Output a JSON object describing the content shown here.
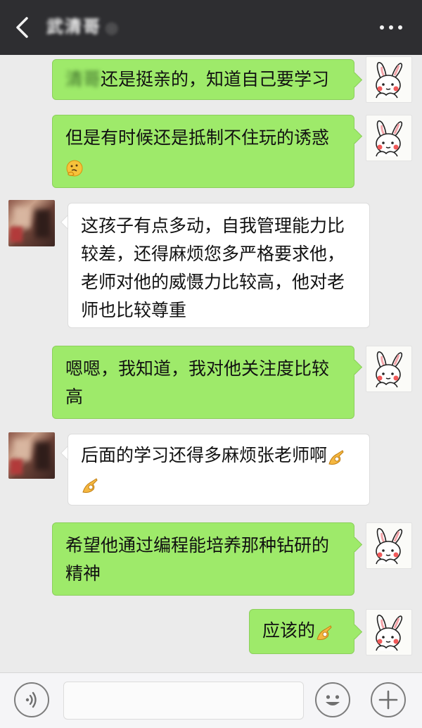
{
  "header": {
    "title": "武清哥",
    "title_mark": "◎",
    "back_icon": "chevron-left-icon",
    "more_icon": "more-dots-icon"
  },
  "messages": [
    {
      "side": "right",
      "name_prefix": "清哥",
      "text": "还是挺亲的，知道自己要学习"
    },
    {
      "side": "right",
      "text": "但是有时候还是抵制不住玩的诱惑",
      "emoji": "thinking-face-icon"
    },
    {
      "side": "left",
      "text": "这孩子有点多动，自我管理能力比较差，还得麻烦您多严格要求他，老师对他的威慑力比较高，他对老师也比较尊重"
    },
    {
      "side": "right",
      "text": "嗯嗯，我知道，我对他关注度比较高"
    },
    {
      "side": "left",
      "text": "后面的学习还得多麻烦张老师啊",
      "emoji": "ok-hand-icon"
    },
    {
      "side": "right",
      "text": "希望他通过编程能培养那种钻研的精神"
    },
    {
      "side": "right",
      "text": "应该的",
      "emoji": "ok-hand-icon"
    }
  ],
  "composer": {
    "voice_icon": "voice-icon",
    "emoji_icon": "smiley-icon",
    "add_icon": "plus-icon"
  },
  "colors": {
    "header_bg": "#2e2e31",
    "chat_bg": "#ebebeb",
    "my_bubble": "#9eea6a",
    "their_bubble": "#ffffff"
  }
}
